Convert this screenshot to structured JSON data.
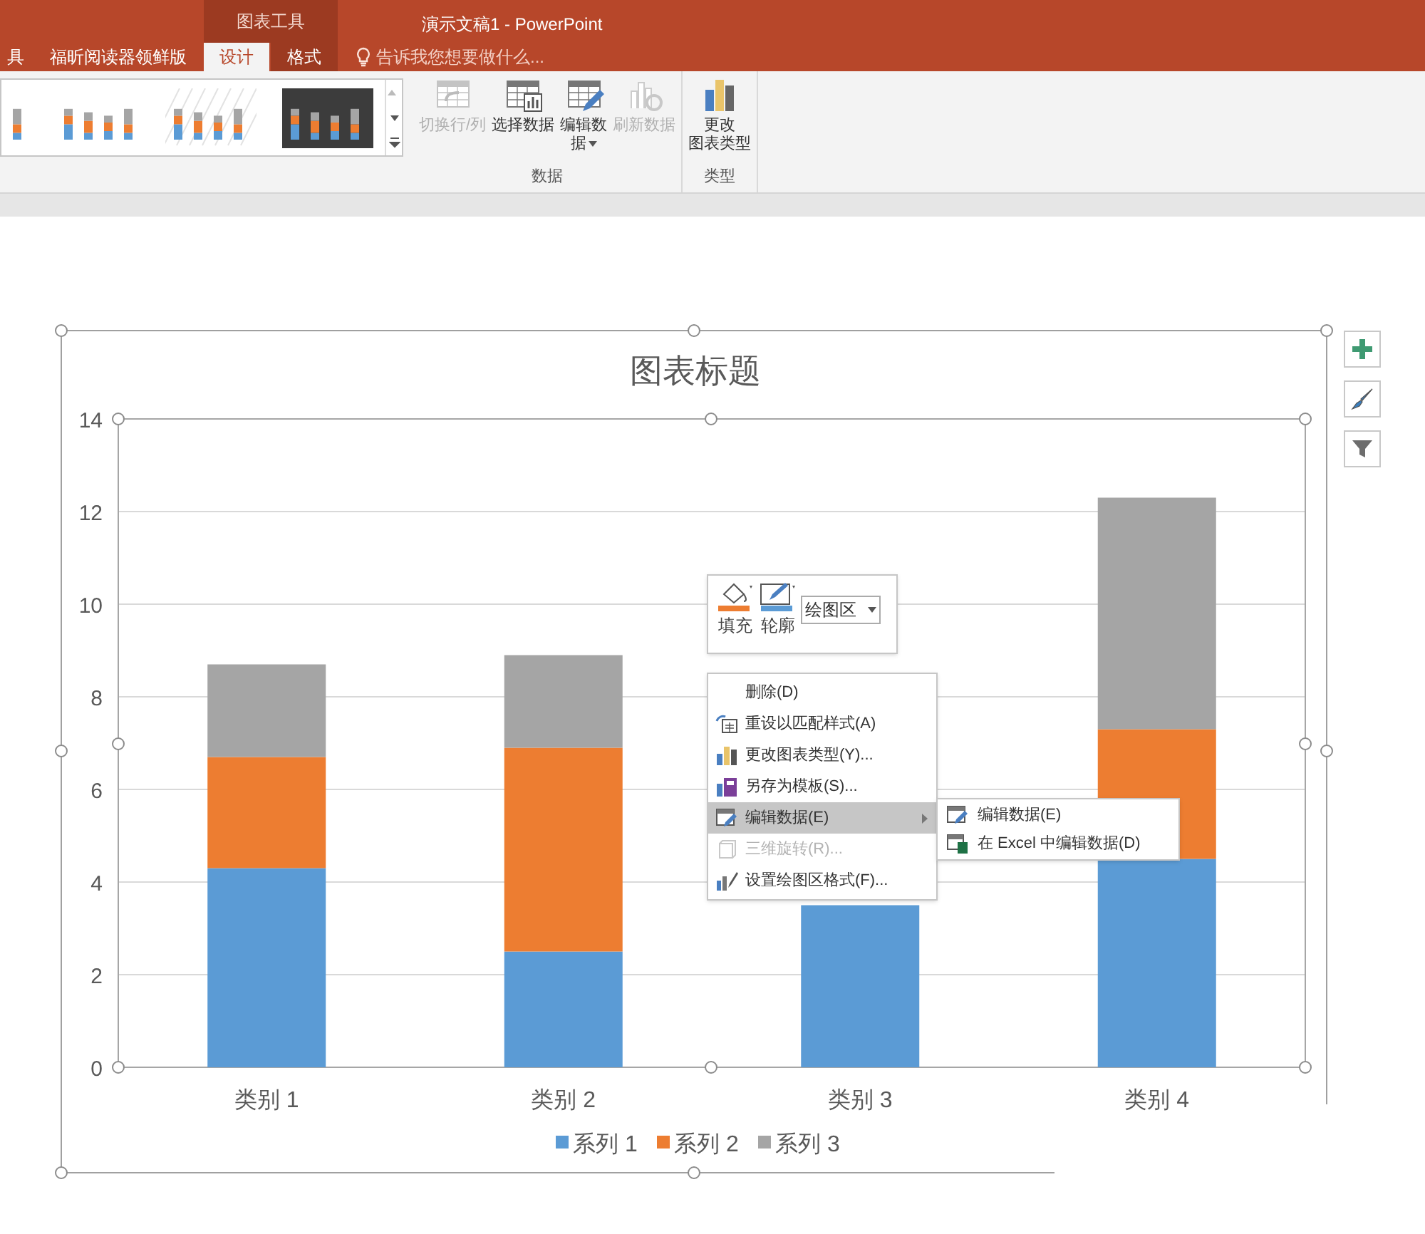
{
  "title_bar": {
    "context_group": "图表工具",
    "title": "演示文稿1 - PowerPoint"
  },
  "tabs": [
    {
      "label": "具",
      "selected": false
    },
    {
      "label": "福昕阅读器领鲜版",
      "selected": false
    },
    {
      "label": "设计",
      "selected": true
    },
    {
      "label": "格式",
      "selected": false
    }
  ],
  "search": {
    "placeholder": "告诉我您想要做什么..."
  },
  "style_gallery": [
    {
      "kind": "plain"
    },
    {
      "kind": "plain"
    },
    {
      "kind": "hatched"
    },
    {
      "kind": "dark"
    }
  ],
  "ribbon_groups": [
    {
      "label": "数据",
      "buttons": [
        {
          "kind": "switch",
          "lines": [
            "切换行/列"
          ],
          "disabled": true,
          "dropdown": false
        },
        {
          "kind": "select",
          "lines": [
            "选择数据"
          ],
          "disabled": false,
          "dropdown": false
        },
        {
          "kind": "edit",
          "lines": [
            "编辑数",
            "据"
          ],
          "disabled": false,
          "dropdown": true
        },
        {
          "kind": "refresh",
          "lines": [
            "刷新数据"
          ],
          "disabled": true,
          "dropdown": false
        }
      ]
    },
    {
      "label": "类型",
      "buttons": [
        {
          "kind": "chart",
          "lines": [
            "更改",
            "图表类型"
          ],
          "disabled": false,
          "dropdown": false
        }
      ]
    }
  ],
  "chart": {
    "chart_data": {
      "type": "bar",
      "title": "图表标题",
      "categories": [
        "类别 1",
        "类别 2",
        "类别 3",
        "类别 4"
      ],
      "stacked": true,
      "grid": true,
      "legend": true,
      "ylim": [
        0,
        14
      ],
      "yticks": [
        0,
        2,
        4,
        6,
        8,
        10,
        12,
        14
      ],
      "series": [
        {
          "name": "系列 1",
          "color": "#5b9bd5",
          "values": [
            4.3,
            2.5,
            3.5,
            4.5
          ]
        },
        {
          "name": "系列 2",
          "color": "#ed7d31",
          "values": [
            2.4,
            4.4,
            null,
            2.8
          ]
        },
        {
          "name": "系列 3",
          "color": "#a5a5a5",
          "values": [
            2,
            2,
            null,
            5
          ]
        }
      ]
    }
  },
  "mini_toolbar": {
    "buttons": [
      {
        "kind": "fill",
        "label": "填充"
      },
      {
        "kind": "outline",
        "label": "轮廓"
      }
    ],
    "dropdown": "绘图区"
  },
  "context_menu": {
    "items": [
      {
        "kind": "none",
        "label": "删除(D)",
        "disabled": false,
        "selected": false,
        "submenu": false
      },
      {
        "kind": "reset",
        "label": "重设以匹配样式(A)",
        "disabled": false,
        "selected": false,
        "submenu": false
      },
      {
        "kind": "chart",
        "label": "更改图表类型(Y)...",
        "disabled": false,
        "selected": false,
        "submenu": false
      },
      {
        "kind": "template",
        "label": "另存为模板(S)...",
        "disabled": false,
        "selected": false,
        "submenu": false
      },
      {
        "kind": "edit",
        "label": "编辑数据(E)",
        "disabled": false,
        "selected": true,
        "submenu": true
      },
      {
        "kind": "rotate",
        "label": "三维旋转(R)...",
        "disabled": true,
        "selected": false,
        "submenu": false
      },
      {
        "kind": "format",
        "label": "设置绘图区格式(F)...",
        "disabled": false,
        "selected": false,
        "submenu": false
      }
    ],
    "submenu": [
      {
        "kind": "edit",
        "label": "编辑数据(E)"
      },
      {
        "kind": "excel",
        "label": "在 Excel 中编辑数据(D)"
      }
    ]
  }
}
